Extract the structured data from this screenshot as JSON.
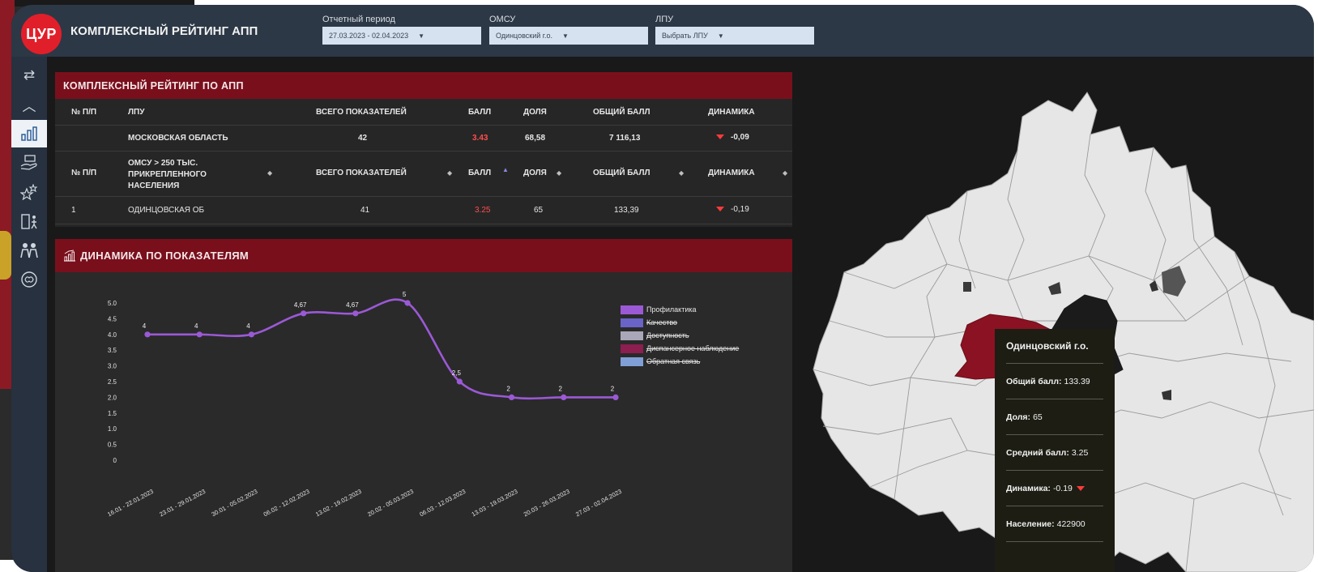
{
  "header": {
    "logo_text": "ЦУР",
    "title": "КОМПЛЕКСНЫЙ РЕЙТИНГ АПП",
    "filters": [
      {
        "label": "Отчетный период",
        "value": "27.03.2023 - 02.04.2023"
      },
      {
        "label": "ОМСУ",
        "value": "Одинцовский г.о."
      },
      {
        "label": "ЛПУ",
        "value": "Выбрать ЛПУ"
      }
    ]
  },
  "sidebar": {
    "items": [
      {
        "icon": "swap-icon",
        "glyph": "⇄"
      },
      {
        "icon": "chevron-up-icon",
        "glyph": "︿"
      },
      {
        "icon": "bar-chart-icon",
        "glyph": "▥",
        "active": true
      },
      {
        "icon": "money-hand-icon",
        "glyph": "💵"
      },
      {
        "icon": "stars-icon",
        "glyph": "✩"
      },
      {
        "icon": "exit-door-icon",
        "glyph": "🚪"
      },
      {
        "icon": "people-icon",
        "glyph": "👥"
      },
      {
        "icon": "brain-icon",
        "glyph": "◎"
      }
    ]
  },
  "rating_panel": {
    "title": "КОМПЛЕКСНЫЙ РЕЙТИНГ ПО АПП",
    "header1": {
      "num": "№ П/П",
      "lpu": "ЛПУ",
      "total": "ВСЕГО ПОКАЗАТЕЛЕЙ",
      "score": "БАЛЛ",
      "share": "ДОЛЯ",
      "overall": "ОБЩИЙ БАЛЛ",
      "dynamics": "ДИНАМИКА"
    },
    "region_row": {
      "name": "МОСКОВСКАЯ ОБЛАСТЬ",
      "total": "42",
      "score": "3.43",
      "share": "68,58",
      "overall": "7 116,13",
      "dynamics": "-0,09"
    },
    "header2": {
      "num": "№ П/П",
      "lpu": "ОМСУ > 250 ТЫС. ПРИКРЕПЛЕННОГО НАСЕЛЕНИЯ",
      "total": "ВСЕГО ПОКАЗАТЕЛЕЙ",
      "score": "БАЛЛ",
      "share": "ДОЛЯ",
      "overall": "ОБЩИЙ БАЛЛ",
      "dynamics": "ДИНАМИКА"
    },
    "data_row": {
      "num": "1",
      "name": "ОДИНЦОВСКАЯ ОБ",
      "total": "41",
      "score": "3.25",
      "share": "65",
      "overall": "133,39",
      "dynamics": "-0,19"
    }
  },
  "dynamics_panel": {
    "title": "ДИНАМИКА ПО ПОКАЗАТЕЛЯМ"
  },
  "chart_data": {
    "type": "line",
    "title": "",
    "xlabel": "",
    "ylabel": "",
    "ylim": [
      0,
      5
    ],
    "yticks": [
      "0",
      "0.5",
      "1.0",
      "1.5",
      "2.0",
      "2.5",
      "3.0",
      "3.5",
      "4.0",
      "4.5",
      "5.0"
    ],
    "categories": [
      "16.01 - 22.01.2023",
      "23.01 - 29.01.2023",
      "30.01 - 05.02.2023",
      "06.02 - 12.02.2023",
      "13.02 - 19.02.2023",
      "20.02 - 05.03.2023",
      "06.03 - 12.03.2023",
      "13.03 - 19.03.2023",
      "20.03 - 26.03.2023",
      "27.03 - 02.04.2023"
    ],
    "series": [
      {
        "name": "Профилактика",
        "values": [
          4,
          4,
          4,
          4.67,
          4.67,
          5,
          2.5,
          2,
          2,
          2
        ],
        "labels": [
          "4",
          "4",
          "4",
          "4,67",
          "4,67",
          "5",
          "2,5",
          "2",
          "2",
          "2"
        ],
        "color": "#9b59d6"
      }
    ],
    "legend": [
      {
        "name": "Профилактика",
        "color": "#9b59d6",
        "active": true
      },
      {
        "name": "Качество",
        "color": "#6a63c8",
        "active": false
      },
      {
        "name": "Доступность",
        "color": "#a9a7b8",
        "active": false
      },
      {
        "name": "Диспансерное наблюдение",
        "color": "#8c1f4f",
        "active": false
      },
      {
        "name": "Обратная связь",
        "color": "#7f9fd6",
        "active": false
      }
    ],
    "legend_position": "right"
  },
  "tooltip": {
    "title": "Одинцовский г.о.",
    "rows": [
      {
        "label": "Общий балл:",
        "value": "133.39"
      },
      {
        "label": "Доля:",
        "value": "65"
      },
      {
        "label": "Средний балл:",
        "value": "3.25"
      },
      {
        "label": "Динамика:",
        "value": "-0.19"
      },
      {
        "label": "Население:",
        "value": "422900"
      }
    ]
  },
  "colors": {
    "accent_red": "#7a0f1c",
    "header_bg": "#2c3846",
    "highlight_region": "#8b1222",
    "map_fill": "#e6e6e6"
  }
}
